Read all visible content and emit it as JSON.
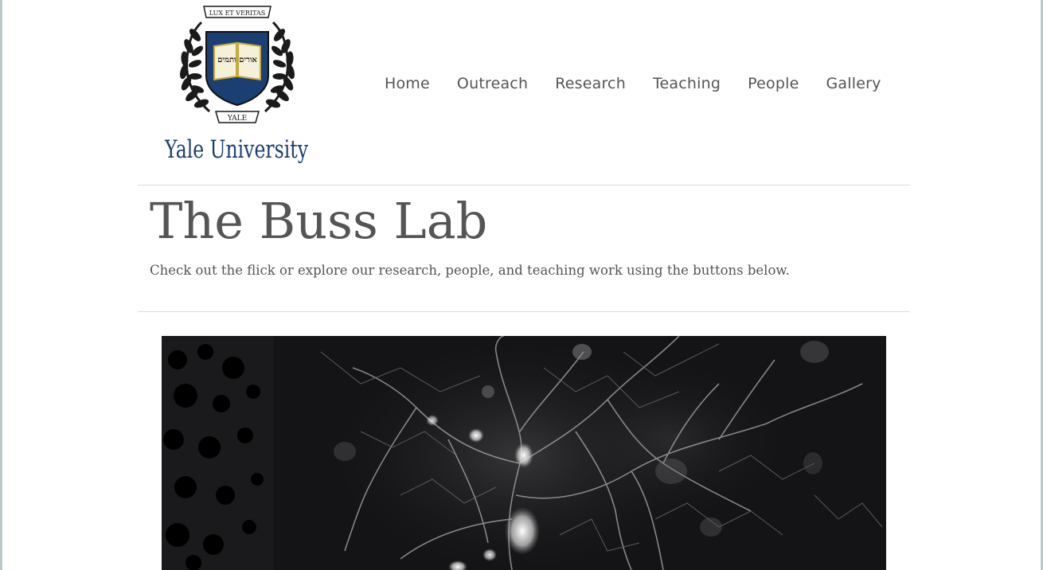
{
  "header": {
    "logo": {
      "motto": "LUX ET VERITAS",
      "hebrew": "אורים ותמים",
      "banner": "YALE",
      "wordmark": "Yale University"
    },
    "nav": [
      {
        "label": "Home"
      },
      {
        "label": "Outreach"
      },
      {
        "label": "Research"
      },
      {
        "label": "Teaching"
      },
      {
        "label": "People"
      },
      {
        "label": "Gallery"
      }
    ]
  },
  "hero": {
    "title": "The Buss Lab",
    "subtitle": "Check out the flick or explore our research, people, and teaching work using the buttons below."
  },
  "colors": {
    "text": "#555555",
    "rule": "#dcdcdc",
    "yale_blue": "#1b3f72",
    "video_bg": "#141416"
  },
  "media": {
    "icon": "microscopy-neuron-video"
  }
}
